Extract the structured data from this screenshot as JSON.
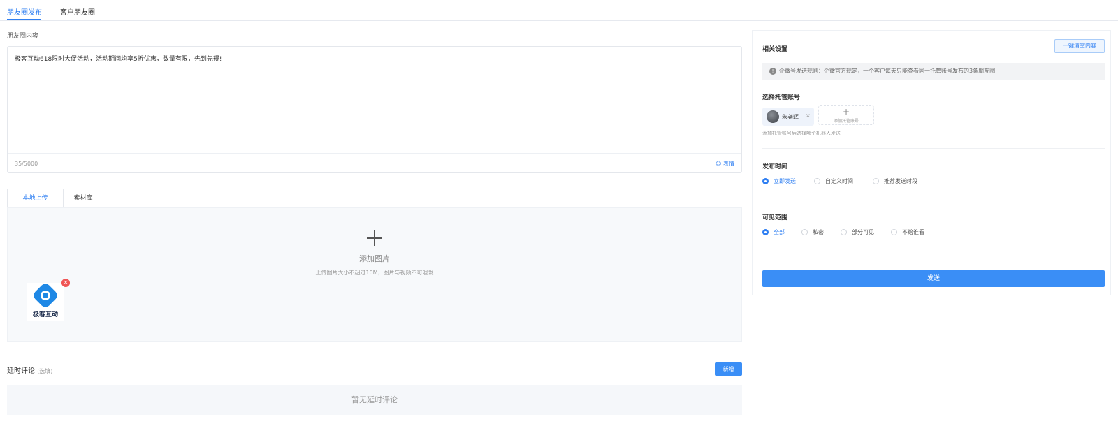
{
  "top_tabs": [
    {
      "label": "朋友圈发布"
    },
    {
      "label": "客户朋友圈"
    }
  ],
  "content": {
    "section_label": "朋友圈内容",
    "text": "极客互动618限时大促活动，活动期间均享5折优惠，数量有限，先到先得!",
    "char_count": "35/5000",
    "emoji_label": "表情"
  },
  "media": {
    "tabs": [
      {
        "label": "本地上传"
      },
      {
        "label": "素材库"
      }
    ],
    "add_image_label": "添加图片",
    "upload_hint": "上传图片大小不超过10M，图片与视频不可混发",
    "thumbnail": {
      "logo_text": "极客互动",
      "logo_color": "#1e88e5",
      "delete_icon": "close-circle-icon"
    }
  },
  "delayed_comments": {
    "title": "延时评论",
    "optional": "(选填)",
    "add_label": "新增",
    "empty_text": "暂无延时评论"
  },
  "settings": {
    "title": "相关设置",
    "clear_label": "一键清空内容",
    "notice_icon": "info-icon",
    "notice": "企微号发送规则：企微官方规定，一个客户每天只能查看同一托管账号发布的3条朋友圈",
    "account_section": {
      "title": "选择托管账号",
      "selected": [
        {
          "name": "朱尧辉"
        }
      ],
      "add_label": "添加托管账号",
      "hint": "添加托管账号后选择哪个机器人发送"
    },
    "publish_time": {
      "title": "发布时间",
      "options": [
        {
          "label": "立即发送",
          "checked": true
        },
        {
          "label": "自定义时间",
          "checked": false
        },
        {
          "label": "推荐发送时段",
          "checked": false
        }
      ]
    },
    "visibility": {
      "title": "可见范围",
      "options": [
        {
          "label": "全部",
          "checked": true
        },
        {
          "label": "私密",
          "checked": false
        },
        {
          "label": "部分可见",
          "checked": false
        },
        {
          "label": "不给谁看",
          "checked": false
        }
      ]
    },
    "send_label": "发送"
  },
  "colors": {
    "accent": "#2f7ff2",
    "primary_button": "#3a8ef6",
    "delete_badge": "#f05454"
  }
}
